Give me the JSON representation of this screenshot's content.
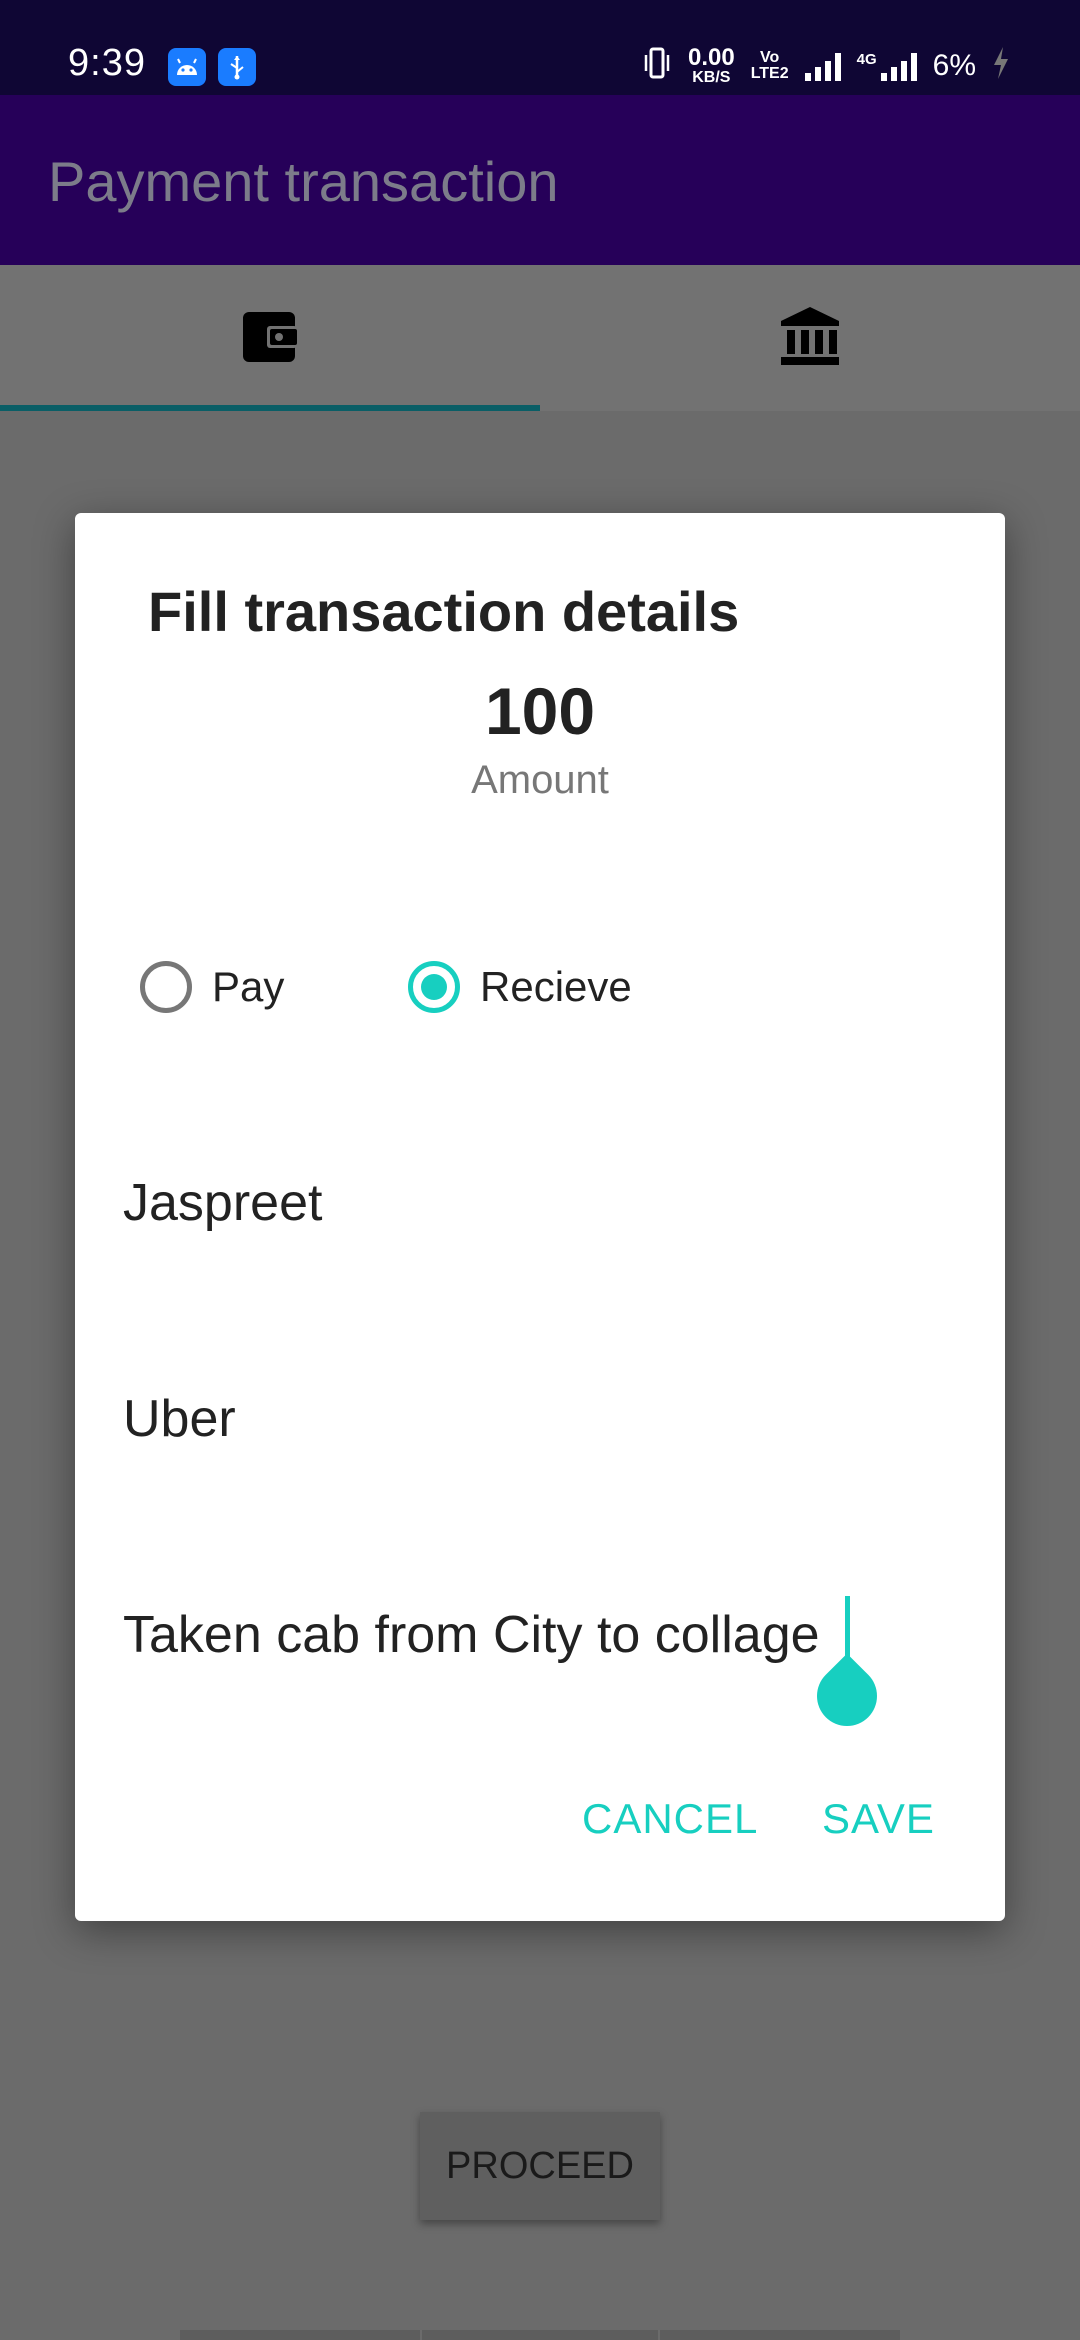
{
  "status_bar": {
    "time": "9:39",
    "net_speed_value": "0.00",
    "net_speed_unit": "KB/S",
    "volte_top": "Vo",
    "volte_bottom": "LTE2",
    "network_type": "4G",
    "battery": "6%"
  },
  "app_bar": {
    "title": "Payment transaction"
  },
  "tabs": [
    {
      "icon": "wallet-icon",
      "selected": true
    },
    {
      "icon": "bank-icon",
      "selected": false
    }
  ],
  "dialog": {
    "title": "Fill transaction details",
    "amount": "100",
    "amount_label": "Amount",
    "radio_options": [
      {
        "label": "Pay",
        "checked": false
      },
      {
        "label": "Recieve",
        "checked": true
      }
    ],
    "fields": {
      "name": "Jaspreet",
      "category": "Uber",
      "description": "Taken cab from City to collage"
    },
    "cancel_label": "CANCEL",
    "save_label": "SAVE"
  },
  "proceed_label": "PROCEED",
  "colors": {
    "accent": "#17cfc0",
    "app_bar": "#260059",
    "status_bar": "#0f0634",
    "tab_indicator": "#0a5e66",
    "scrim": "#6b6b6b"
  }
}
